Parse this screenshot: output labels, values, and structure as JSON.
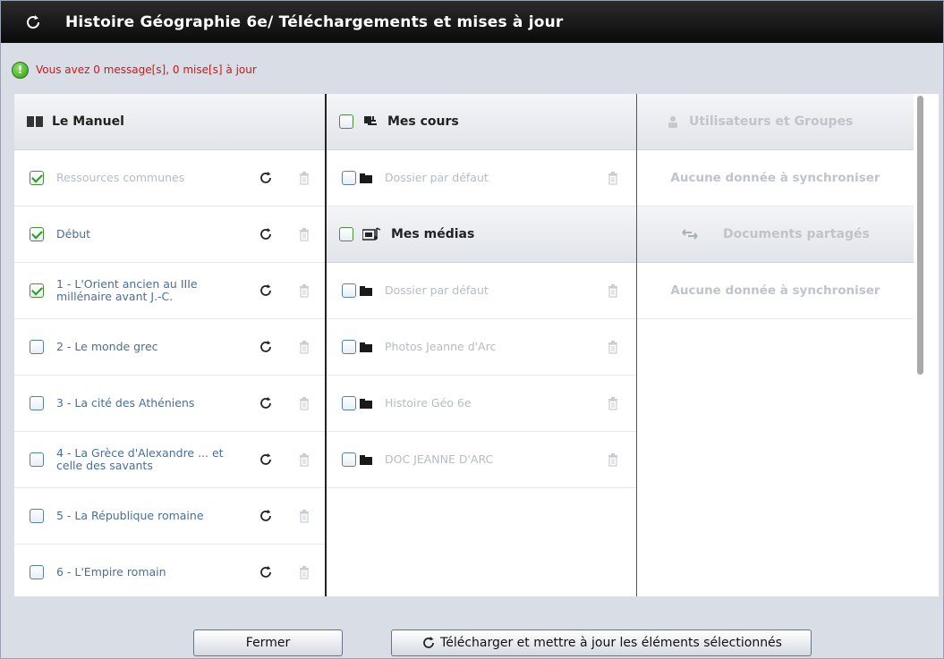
{
  "window": {
    "title": "Histoire Géographie 6e/ Téléchargements et mises à jour"
  },
  "status": {
    "message": "Vous avez 0 message[s], 0 mise[s] à jour",
    "icon": "ok-circle-icon",
    "color": "#d01818"
  },
  "manuel": {
    "title": "Le Manuel",
    "items": [
      {
        "label": "Ressources communes",
        "checked": true,
        "enabled": false
      },
      {
        "label": "Début",
        "checked": true,
        "enabled": true
      },
      {
        "label": "1 - L'Orient ancien au IIIe millénaire avant J.-C.",
        "checked": true,
        "enabled": true
      },
      {
        "label": "2 - Le monde grec",
        "checked": false,
        "enabled": true
      },
      {
        "label": "3 - La cité des Athéniens",
        "checked": false,
        "enabled": true
      },
      {
        "label": "4 - La Grèce d'Alexandre ... et celle des savants",
        "checked": false,
        "enabled": true
      },
      {
        "label": "5 - La République romaine",
        "checked": false,
        "enabled": true
      },
      {
        "label": "6 - L'Empire romain",
        "checked": false,
        "enabled": true
      }
    ]
  },
  "cours": {
    "title": "Mes cours",
    "items": [
      {
        "label": "Dossier par défaut"
      }
    ]
  },
  "medias": {
    "title": "Mes médias",
    "items": [
      {
        "label": "Dossier par défaut"
      },
      {
        "label": "Photos Jeanne d'Arc"
      },
      {
        "label": "Histoire Géo 6e"
      },
      {
        "label": "DOC JEANNE D'ARC"
      }
    ]
  },
  "users": {
    "title": "Utilisateurs et Groupes",
    "empty": "Aucune donnée à synchroniser"
  },
  "shared": {
    "title": "Documents partagés",
    "empty": "Aucune donnée à synchroniser"
  },
  "buttons": {
    "close": "Fermer",
    "download": "Télécharger et mettre à jour les éléments sélectionnés"
  },
  "colors": {
    "link": "#4a6e98",
    "disabled": "#b6bcc4",
    "check": "#2c9a1a"
  }
}
